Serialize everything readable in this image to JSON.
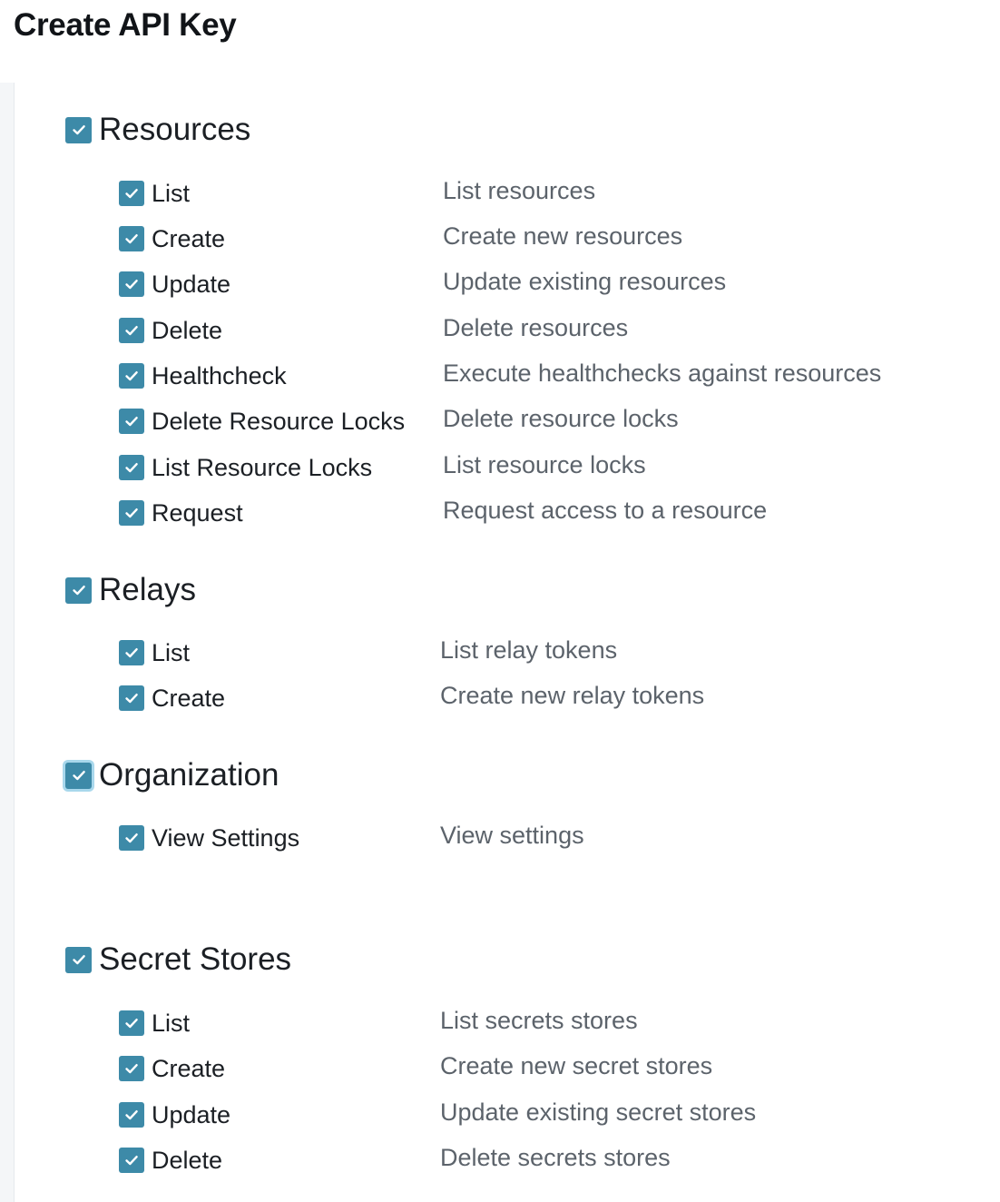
{
  "page": {
    "title": "Create API Key"
  },
  "colors": {
    "checkbox_fill": "#3d8aa8",
    "checkbox_focus_ring": "#a9d8ec",
    "description_text": "#5c636b"
  },
  "icons": {
    "checkbox": "checkbox-checked-icon"
  },
  "groups": [
    {
      "name": "Resources",
      "checked": true,
      "permissions": [
        {
          "label": "List",
          "description": "List resources",
          "checked": true
        },
        {
          "label": "Create",
          "description": "Create new resources",
          "checked": true
        },
        {
          "label": "Update",
          "description": "Update existing resources",
          "checked": true
        },
        {
          "label": "Delete",
          "description": "Delete resources",
          "checked": true
        },
        {
          "label": "Healthcheck",
          "description": "Execute healthchecks against resources",
          "checked": true
        },
        {
          "label": "Delete Resource Locks",
          "description": "Delete resource locks",
          "checked": true
        },
        {
          "label": "List Resource Locks",
          "description": "List resource locks",
          "checked": true
        },
        {
          "label": "Request",
          "description": "Request access to a resource",
          "checked": true
        }
      ]
    },
    {
      "name": "Relays",
      "checked": true,
      "permissions": [
        {
          "label": "List",
          "description": "List relay tokens",
          "checked": true
        },
        {
          "label": "Create",
          "description": "Create new relay tokens",
          "checked": true
        }
      ]
    },
    {
      "name": "Organization",
      "checked": true,
      "focused": true,
      "permissions": [
        {
          "label": "View Settings",
          "description": "View settings",
          "checked": true
        }
      ]
    },
    {
      "name": "Secret Stores",
      "checked": true,
      "permissions": [
        {
          "label": "List",
          "description": "List secrets stores",
          "checked": true
        },
        {
          "label": "Create",
          "description": "Create new secret stores",
          "checked": true
        },
        {
          "label": "Update",
          "description": "Update existing secret stores",
          "checked": true
        },
        {
          "label": "Delete",
          "description": "Delete secrets stores",
          "checked": true
        }
      ]
    }
  ]
}
